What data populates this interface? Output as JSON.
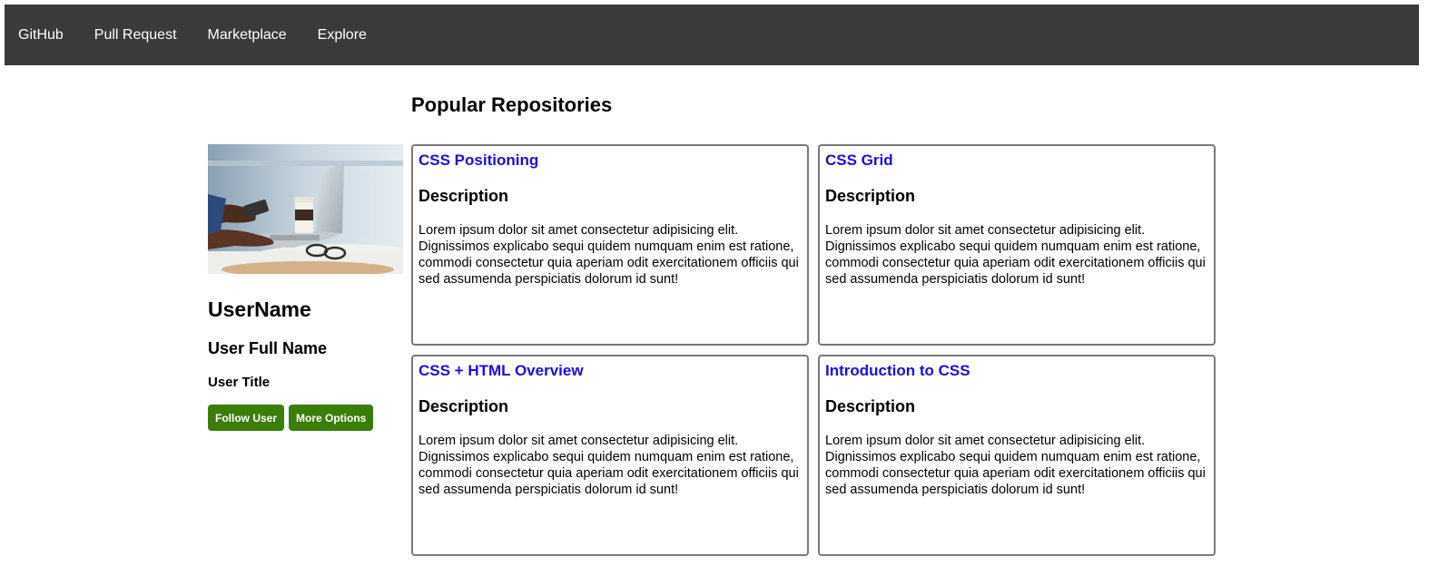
{
  "nav": {
    "items": [
      {
        "label": "GitHub"
      },
      {
        "label": "Pull Request"
      },
      {
        "label": "Marketplace"
      },
      {
        "label": "Explore"
      }
    ]
  },
  "profile": {
    "avatar_alt": "Person using a laptop with a coffee cup and glasses on a table",
    "username": "UserName",
    "full_name": "User Full Name",
    "title": "User Title",
    "follow_label": "Follow User",
    "options_label": "More Options"
  },
  "repos": {
    "heading": "Popular Repositories",
    "items": [
      {
        "name": "CSS Positioning",
        "desc_heading": "Description",
        "desc": "Lorem ipsum dolor sit amet consectetur adipisicing elit. Dignissimos explicabo sequi quidem numquam enim est ratione, commodi consectetur quia aperiam odit exercitationem officiis qui sed assumenda perspiciatis dolorum id sunt!"
      },
      {
        "name": "CSS Grid",
        "desc_heading": "Description",
        "desc": "Lorem ipsum dolor sit amet consectetur adipisicing elit. Dignissimos explicabo sequi quidem numquam enim est ratione, commodi consectetur quia aperiam odit exercitationem officiis qui sed assumenda perspiciatis dolorum id sunt!"
      },
      {
        "name": "CSS + HTML Overview",
        "desc_heading": "Description",
        "desc": "Lorem ipsum dolor sit amet consectetur adipisicing elit. Dignissimos explicabo sequi quidem numquam enim est ratione, commodi consectetur quia aperiam odit exercitationem officiis qui sed assumenda perspiciatis dolorum id sunt!"
      },
      {
        "name": "Introduction to CSS",
        "desc_heading": "Description",
        "desc": "Lorem ipsum dolor sit amet consectetur adipisicing elit. Dignissimos explicabo sequi quidem numquam enim est ratione, commodi consectetur quia aperiam odit exercitationem officiis qui sed assumenda perspiciatis dolorum id sunt!"
      }
    ]
  },
  "colors": {
    "navbar": "#3a3a3a",
    "button": "#3a7d0a",
    "link": "#1c0ce0",
    "card_border": "#7a7a7a"
  }
}
